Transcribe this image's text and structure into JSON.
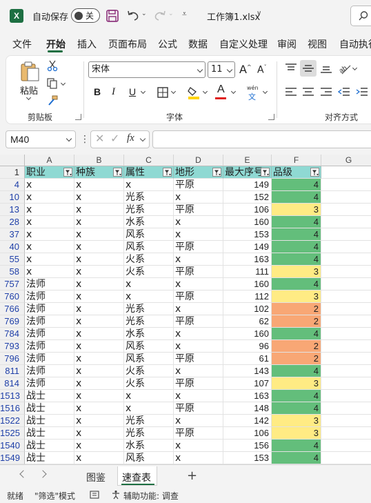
{
  "titlebar": {
    "autosave_label": "自动保存",
    "autosave_state": "关",
    "filename": "工作簿1.xlsx",
    "app_icon_letter": "X"
  },
  "menu": {
    "tabs": [
      "文件",
      "开始",
      "插入",
      "页面布局",
      "公式",
      "数据",
      "自定义处理",
      "审阅",
      "视图",
      "自动执行"
    ],
    "active_tab": "开始"
  },
  "ribbon": {
    "clipboard": {
      "paste_label": "粘贴",
      "group_label": "剪贴板"
    },
    "font": {
      "font_name": "宋体",
      "font_size": "11",
      "bold": "B",
      "italic": "I",
      "underline": "U",
      "font_color_letter": "A",
      "phonetic_top": "wén",
      "phonetic_bottom": "文",
      "group_label": "字体",
      "highlight_color": "#ffd400",
      "font_color": "#e0201b"
    },
    "alignment": {
      "group_label": "对齐方式"
    }
  },
  "formula_bar": {
    "name_box": "M40",
    "fx_label": "fx",
    "formula": ""
  },
  "grid": {
    "columns": [
      "A",
      "B",
      "C",
      "D",
      "E",
      "F",
      "G"
    ],
    "header_row_number": "1",
    "headers": [
      "职业",
      "种族",
      "属性",
      "地形",
      "最大序号",
      "品级"
    ],
    "rows": [
      {
        "num": "4",
        "cells": [
          "x",
          "x",
          "x",
          "平原",
          "149",
          "4"
        ]
      },
      {
        "num": "10",
        "cells": [
          "x",
          "x",
          "光系",
          "x",
          "152",
          "4"
        ]
      },
      {
        "num": "13",
        "cells": [
          "x",
          "x",
          "光系",
          "平原",
          "106",
          "3"
        ]
      },
      {
        "num": "28",
        "cells": [
          "x",
          "x",
          "水系",
          "x",
          "160",
          "4"
        ]
      },
      {
        "num": "37",
        "cells": [
          "x",
          "x",
          "风系",
          "x",
          "153",
          "4"
        ]
      },
      {
        "num": "40",
        "cells": [
          "x",
          "x",
          "风系",
          "平原",
          "149",
          "4"
        ]
      },
      {
        "num": "55",
        "cells": [
          "x",
          "x",
          "火系",
          "x",
          "163",
          "4"
        ]
      },
      {
        "num": "58",
        "cells": [
          "x",
          "x",
          "火系",
          "平原",
          "111",
          "3"
        ]
      },
      {
        "num": "757",
        "cells": [
          "法师",
          "x",
          "x",
          "x",
          "160",
          "4"
        ]
      },
      {
        "num": "760",
        "cells": [
          "法师",
          "x",
          "x",
          "平原",
          "112",
          "3"
        ]
      },
      {
        "num": "766",
        "cells": [
          "法师",
          "x",
          "光系",
          "x",
          "102",
          "2"
        ]
      },
      {
        "num": "769",
        "cells": [
          "法师",
          "x",
          "光系",
          "平原",
          "62",
          "2"
        ]
      },
      {
        "num": "784",
        "cells": [
          "法师",
          "x",
          "水系",
          "x",
          "160",
          "4"
        ]
      },
      {
        "num": "793",
        "cells": [
          "法师",
          "x",
          "风系",
          "x",
          "96",
          "2"
        ]
      },
      {
        "num": "796",
        "cells": [
          "法师",
          "x",
          "风系",
          "平原",
          "61",
          "2"
        ]
      },
      {
        "num": "811",
        "cells": [
          "法师",
          "x",
          "火系",
          "x",
          "143",
          "4"
        ]
      },
      {
        "num": "814",
        "cells": [
          "法师",
          "x",
          "火系",
          "平原",
          "107",
          "3"
        ]
      },
      {
        "num": "1513",
        "cells": [
          "战士",
          "x",
          "x",
          "x",
          "163",
          "4"
        ]
      },
      {
        "num": "1516",
        "cells": [
          "战士",
          "x",
          "x",
          "平原",
          "148",
          "4"
        ]
      },
      {
        "num": "1522",
        "cells": [
          "战士",
          "x",
          "光系",
          "x",
          "142",
          "3"
        ]
      },
      {
        "num": "1525",
        "cells": [
          "战士",
          "x",
          "光系",
          "平原",
          "106",
          "3"
        ]
      },
      {
        "num": "1540",
        "cells": [
          "战士",
          "x",
          "水系",
          "x",
          "156",
          "4"
        ]
      },
      {
        "num": "1549",
        "cells": [
          "战士",
          "x",
          "风系",
          "x",
          "153",
          "4"
        ]
      }
    ],
    "grade_colors": {
      "4": "#63be7b",
      "3": "#ffeb84",
      "2": "#f8a775"
    },
    "header_fill": "#8fd9d3"
  },
  "sheets": {
    "tabs": [
      "图鉴",
      "速查表"
    ],
    "active": "速查表"
  },
  "statusbar": {
    "ready": "就绪",
    "filter_mode": "\"筛选\"模式",
    "accessibility": "辅助功能: 调查"
  }
}
